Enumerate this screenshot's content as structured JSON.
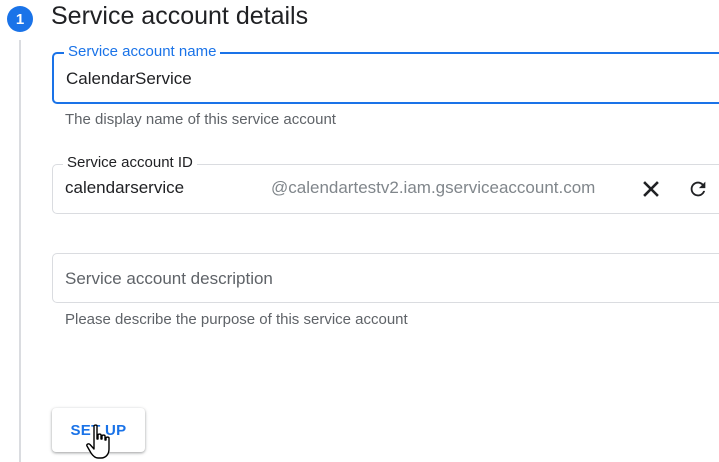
{
  "step": {
    "number": "1",
    "title": "Service account details"
  },
  "name_field": {
    "label": "Service account name",
    "value": "CalendarService",
    "hint": "The display name of this service account"
  },
  "id_field": {
    "label": "Service account ID",
    "value": "calendarservice",
    "suffix": "@calendartestv2.iam.gserviceaccount.com",
    "clear_icon": "close-icon",
    "refresh_icon": "refresh-icon"
  },
  "description_field": {
    "placeholder": "Service account description",
    "hint": "Please describe the purpose of this service account"
  },
  "actions": {
    "setup_label": "SET UP"
  },
  "colors": {
    "accent": "#1a73e8",
    "border": "#dadce0",
    "text": "#202124",
    "secondary_text": "#5f6368"
  }
}
